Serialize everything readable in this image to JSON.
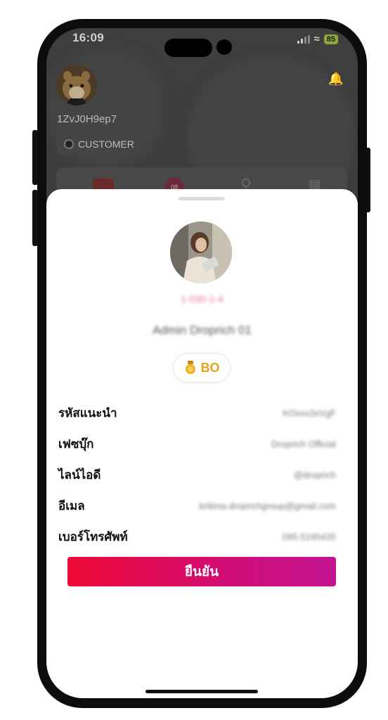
{
  "status_bar": {
    "time": "16:09",
    "battery": "85"
  },
  "background_app": {
    "username": "1ZvJ0H9ep7",
    "role": "CUSTOMER",
    "menu_badge": "08"
  },
  "profile": {
    "code": "1-030-1-4",
    "name": "Admin Droprich 01",
    "rank": "BO"
  },
  "details": [
    {
      "label": "รหัสแนะนำ",
      "value": "KOxxx3xVgF"
    },
    {
      "label": "เฟซบุ๊ก",
      "value": "Droprich Official"
    },
    {
      "label": "ไลน์ไอดี",
      "value": "@droprich"
    },
    {
      "label": "อีเมล",
      "value": "kritima.droprichgroup@gmail.com"
    },
    {
      "label": "เบอร์โทรศัพท์",
      "value": "095-5195435"
    }
  ],
  "confirm_label": "ยืนยัน",
  "colors": {
    "accent_start": "#ee0a36",
    "accent_end": "#c2138f",
    "rank": "#e4a51b"
  }
}
